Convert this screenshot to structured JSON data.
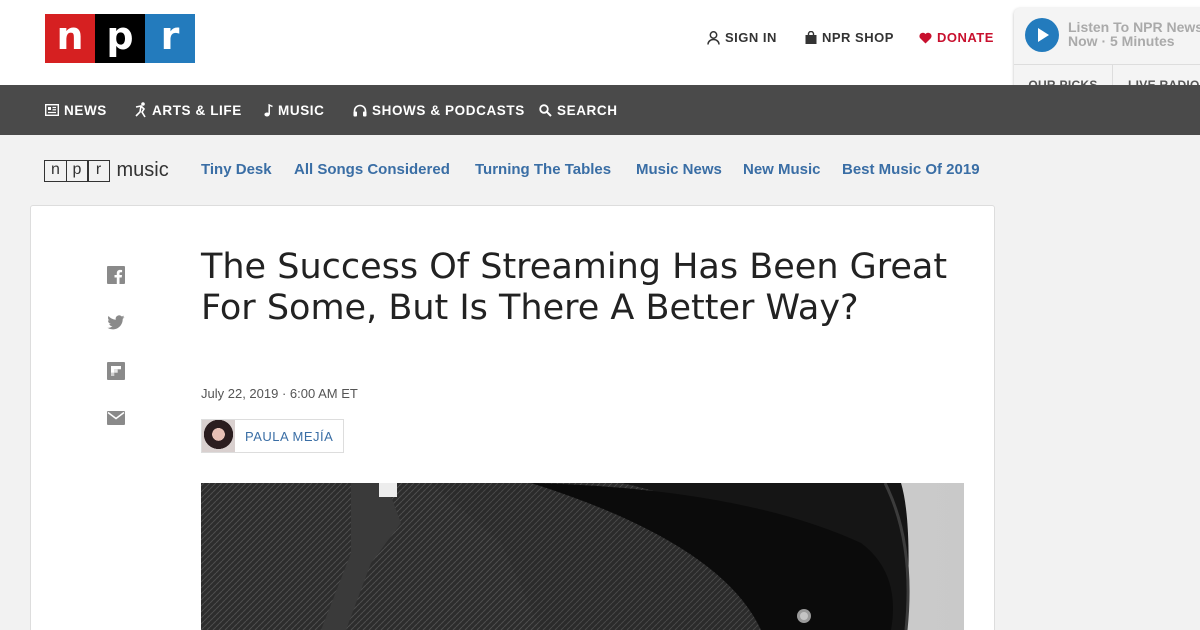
{
  "logo": {
    "letters": [
      "n",
      "p",
      "r"
    ]
  },
  "utility": {
    "signin": "SIGN IN",
    "shop": "NPR SHOP",
    "donate": "DONATE"
  },
  "player": {
    "title": "Listen To NPR News Now · 5 Minutes",
    "tabs": [
      "OUR PICKS",
      "LIVE RADIO"
    ]
  },
  "nav": {
    "items": [
      {
        "label": "NEWS",
        "icon": "news-icon"
      },
      {
        "label": "ARTS & LIFE",
        "icon": "arts-icon"
      },
      {
        "label": "MUSIC",
        "icon": "music-note-icon"
      },
      {
        "label": "SHOWS & PODCASTS",
        "icon": "headphones-icon"
      },
      {
        "label": "SEARCH",
        "icon": "search-icon"
      }
    ]
  },
  "section": {
    "logo_letters": [
      "n",
      "p",
      "r"
    ],
    "logo_word": "music",
    "links": [
      "Tiny Desk",
      "All Songs Considered",
      "Turning The Tables",
      "Music News",
      "New Music",
      "Best Music Of 2019"
    ]
  },
  "share": [
    "facebook-icon",
    "twitter-icon",
    "flipboard-icon",
    "email-icon"
  ],
  "article": {
    "headline": "The Success Of Streaming Has Been Great For Some, But Is There A Better Way?",
    "date": "July 22, 2019 · 6:00 AM ET",
    "author": "PAULA MEJÍA"
  },
  "colors": {
    "npr_red": "#d62021",
    "npr_blue": "#237bbd",
    "nav_bg": "#4a4a4a",
    "link": "#3a6ea5",
    "donate": "#c8102e"
  }
}
